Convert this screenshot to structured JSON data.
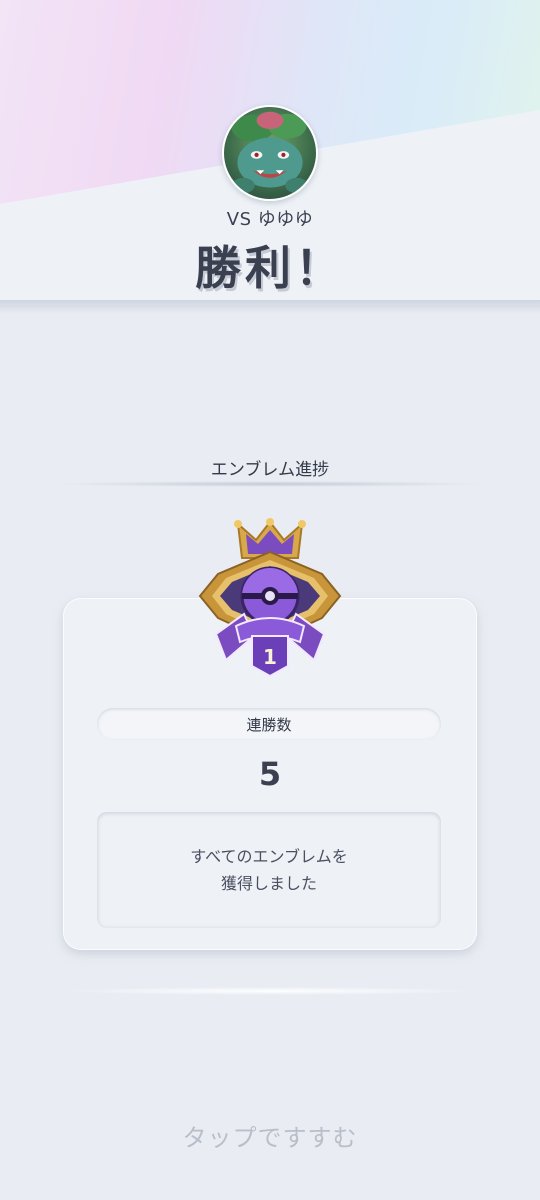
{
  "header": {
    "opponent_text": "VS ゆゆゆ",
    "result": "勝利！"
  },
  "emblem_progress": {
    "title": "エンブレム進捗",
    "emblem_rank": "1",
    "stat_label": "連勝数",
    "stat_value": "5",
    "message_line1": "すべてのエンブレムを",
    "message_line2": "獲得しました"
  },
  "footer": {
    "tap_prompt": "タップですすむ"
  },
  "colors": {
    "emblem_purple": "#6a3fb8",
    "emblem_gold": "#d9a84a",
    "text_dark": "#3a4050"
  }
}
